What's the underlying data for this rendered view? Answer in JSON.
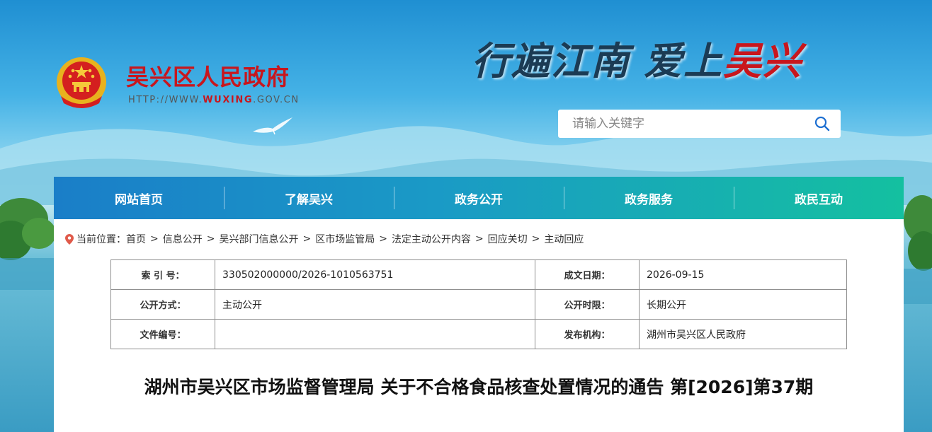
{
  "header": {
    "site_name": "吴兴区人民政府",
    "site_url_prefix": "HTTP://WWW.",
    "site_url_domain": "WUXING",
    "site_url_suffix": ".GOV.CN",
    "slogan_part1": "行遍江南",
    "slogan_part2": "爱上",
    "slogan_part3": "吴兴"
  },
  "search": {
    "placeholder": "请输入关键字"
  },
  "nav": {
    "items": [
      "网站首页",
      "了解吴兴",
      "政务公开",
      "政务服务",
      "政民互动"
    ]
  },
  "breadcrumb": {
    "label": "当前位置：",
    "items": [
      "首页",
      "信息公开",
      "吴兴部门信息公开",
      "区市场监管局",
      "法定主动公开内容",
      "回应关切",
      "主动回应"
    ],
    "separator": ">"
  },
  "meta": {
    "index_label": "索 引 号：",
    "index_value": "330502000000/2026-1010563751",
    "date_label": "成文日期：",
    "date_value": "2026-09-15",
    "method_label": "公开方式：",
    "method_value": "主动公开",
    "period_label": "公开时限：",
    "period_value": "长期公开",
    "docno_label": "文件编号：",
    "docno_value": "",
    "org_label": "发布机构：",
    "org_value": "湖州市吴兴区人民政府"
  },
  "article": {
    "title": "湖州市吴兴区市场监督管理局 关于不合格食品核查处置情况的通告 第[2026]第37期"
  },
  "colors": {
    "brand_red": "#c8161d",
    "nav_start": "#1a7ec8",
    "nav_end": "#14c0a0"
  }
}
